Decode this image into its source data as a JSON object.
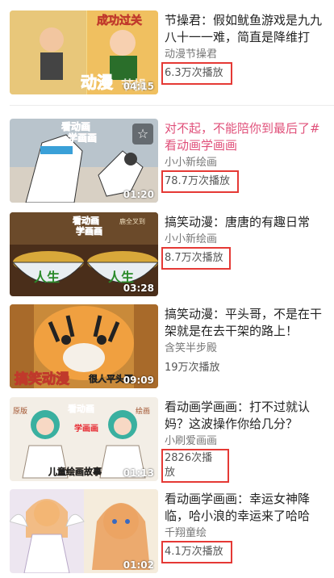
{
  "videos": [
    {
      "title": "节操君：假如鱿鱼游戏是九九八十一一难，简直是降维打击...",
      "author": "动漫节操君",
      "plays": "6.3万次播放",
      "duration": "04:15",
      "thumb_text": "成功过关",
      "thumb_text2": "动漫",
      "thumb_text3": "节操"
    },
    {
      "title": "对不起，不能陪你到最后了#看动画学画画",
      "author": "小小新绘画",
      "plays": "78.7万次播放",
      "duration": "01:20",
      "thumb_text": "看动画",
      "thumb_text2": "学画画"
    },
    {
      "title": "搞笑动漫：唐唐的有趣日常",
      "author": "小小新绘画",
      "plays": "8.7万次播放",
      "duration": "03:28",
      "thumb_text": "看动画",
      "thumb_text2": "学画画",
      "thumb_text3": "人生",
      "thumb_text4": "人生",
      "thumb_text5": "鹿全叉到"
    },
    {
      "title": "搞笑动漫：平头哥，不是在干架就是在去干架的路上！",
      "author": "含笑半步殿",
      "plays": "19万次播放",
      "duration": "09:09",
      "thumb_text": "搞笑动漫",
      "thumb_text2": "很人平头哥"
    },
    {
      "title": "看动画学画画：打不过就认妈？这波操作你给几分？",
      "author": "小刷爱画画",
      "plays": "2826次播放",
      "duration": "01:13",
      "thumb_text": "看动画",
      "thumb_text2": "学画画",
      "thumb_text3": "儿童绘画故事",
      "thumb_text4": "原版",
      "thumb_text5": "绘画"
    },
    {
      "title": "看动画学画画：幸运女神降临，哈小浪的幸运来了哈哈",
      "author": "千翔童绘",
      "plays": "4.1万次播放",
      "duration": "01:02"
    }
  ],
  "icons": {
    "star": "star-icon"
  },
  "colors": {
    "highlight_box": "#e53935",
    "pink_title": "#e0507a"
  }
}
